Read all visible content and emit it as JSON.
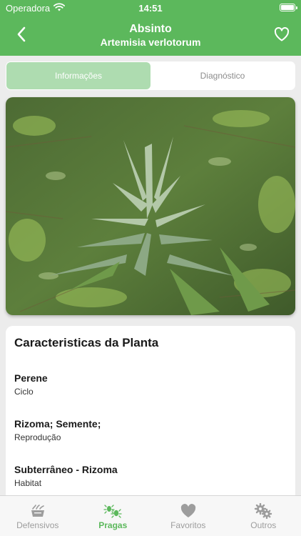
{
  "status_bar": {
    "carrier": "Operadora",
    "time": "14:51"
  },
  "nav": {
    "title": "Absinto",
    "subtitle": "Artemisia verlotorum",
    "back_icon": "chevron-left-icon",
    "favorite_icon": "heart-outline-icon"
  },
  "segments": [
    {
      "label": "Informações",
      "selected": true
    },
    {
      "label": "Diagnóstico",
      "selected": false
    }
  ],
  "colors": {
    "brand": "#5cb85c",
    "segment_active": "#aedcb0"
  },
  "characteristics": {
    "title": "Caracteristicas da Planta",
    "items": [
      {
        "value": "Perene",
        "label": "Ciclo"
      },
      {
        "value": "Rizoma; Semente;",
        "label": "Reprodução"
      },
      {
        "value": "Subterrâneo - Rizoma",
        "label": "Habitat"
      }
    ]
  },
  "tabs": [
    {
      "label": "Defensivos",
      "icon": "sprayer-icon",
      "active": false
    },
    {
      "label": "Pragas",
      "icon": "bugs-icon",
      "active": true
    },
    {
      "label": "Favoritos",
      "icon": "heart-icon",
      "active": false
    },
    {
      "label": "Outros",
      "icon": "gears-icon",
      "active": false
    }
  ]
}
